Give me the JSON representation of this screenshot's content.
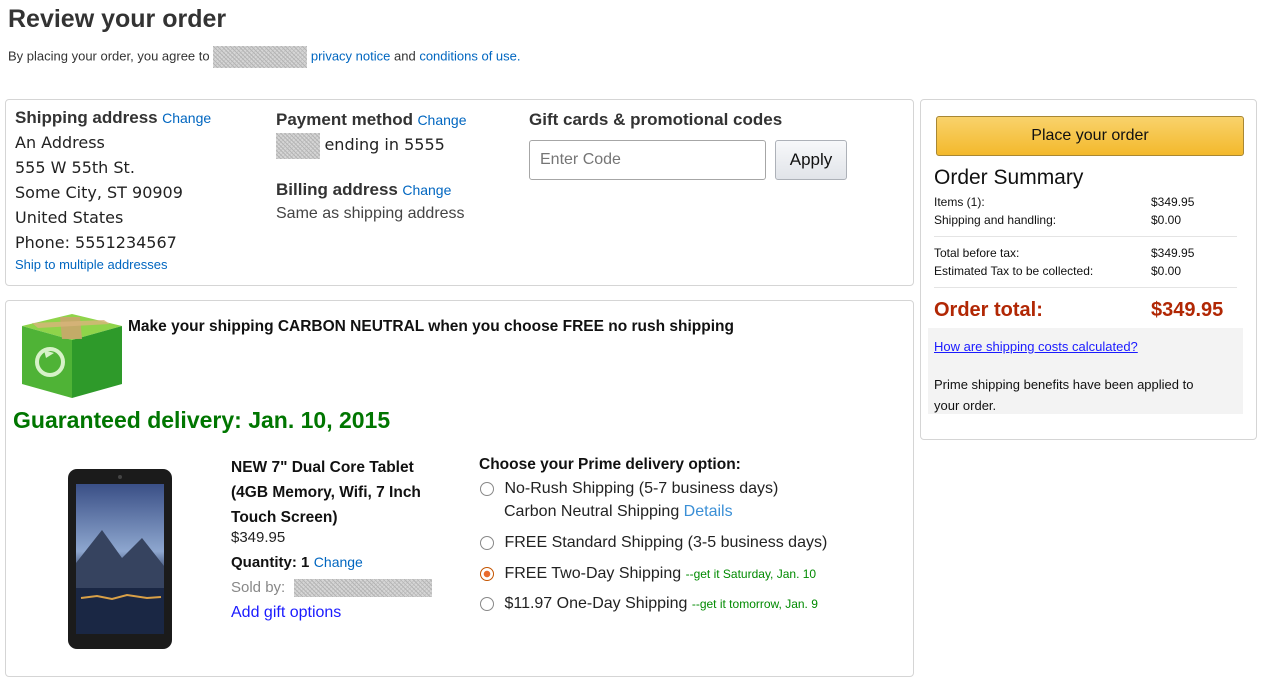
{
  "header": {
    "title": "Review your order",
    "agree_prefix": "By placing your order, you agree to",
    "privacy_link": "privacy notice",
    "and_text": "and",
    "conditions_link": "conditions of use."
  },
  "shipping": {
    "title": "Shipping address",
    "change": "Change",
    "lines": [
      "An Address",
      "555 W 55th St.",
      "Some City, ST 90909",
      "United States",
      "Phone: 5551234567"
    ],
    "multi_link": "Ship to multiple addresses"
  },
  "payment": {
    "title": "Payment method",
    "change": "Change",
    "ending_text": "ending in 5555",
    "billing_title": "Billing address",
    "billing_change": "Change",
    "billing_value": "Same as shipping address"
  },
  "gift": {
    "title": "Gift cards & promotional codes",
    "placeholder": "Enter Code",
    "apply": "Apply"
  },
  "carbon": {
    "message": "Make your shipping CARBON NEUTRAL when you choose FREE no rush shipping",
    "guaranteed": "Guaranteed delivery: Jan. 10, 2015"
  },
  "product": {
    "title_lines": [
      "NEW 7\" Dual Core Tablet",
      "(4GB Memory, Wifi, 7 Inch",
      "Touch Screen)"
    ],
    "price": "$349.95",
    "quantity_label": "Quantity: 1",
    "quantity_change": "Change",
    "sold_by": "Sold by:",
    "gift_options": "Add gift options"
  },
  "delivery": {
    "title": "Choose your Prime delivery option:",
    "options": [
      {
        "label": "No-Rush Shipping (5-7 business days)",
        "sub": "Carbon Neutral Shipping",
        "sub_link": "Details",
        "selected": false
      },
      {
        "label": "FREE Standard Shipping (3-5 business days)",
        "selected": false
      },
      {
        "label": "FREE Two-Day Shipping",
        "note": "--get it Saturday, Jan. 10",
        "selected": true
      },
      {
        "label": "$11.97 One-Day Shipping",
        "note": "--get it tomorrow, Jan. 9",
        "selected": false
      }
    ]
  },
  "summary": {
    "place_order": "Place your order",
    "title": "Order Summary",
    "rows": [
      {
        "label": "Items (1):",
        "value": "$349.95"
      },
      {
        "label": "Shipping and handling:",
        "value": "$0.00"
      },
      {
        "label": "Total before tax:",
        "value": "$349.95"
      },
      {
        "label": "Estimated Tax to be collected:",
        "value": "$0.00"
      }
    ],
    "total_label": "Order total:",
    "total_value": "$349.95",
    "shipping_costs_link": "How are shipping costs calculated?",
    "prime_note_1": "Prime shipping benefits have been applied to",
    "prime_note_2": "your order."
  },
  "colors": {
    "link": "#0066c0",
    "place_button": "#f7c543",
    "total_red": "#b12704",
    "guaranteed_green": "#007600",
    "note_green": "#008a00"
  }
}
